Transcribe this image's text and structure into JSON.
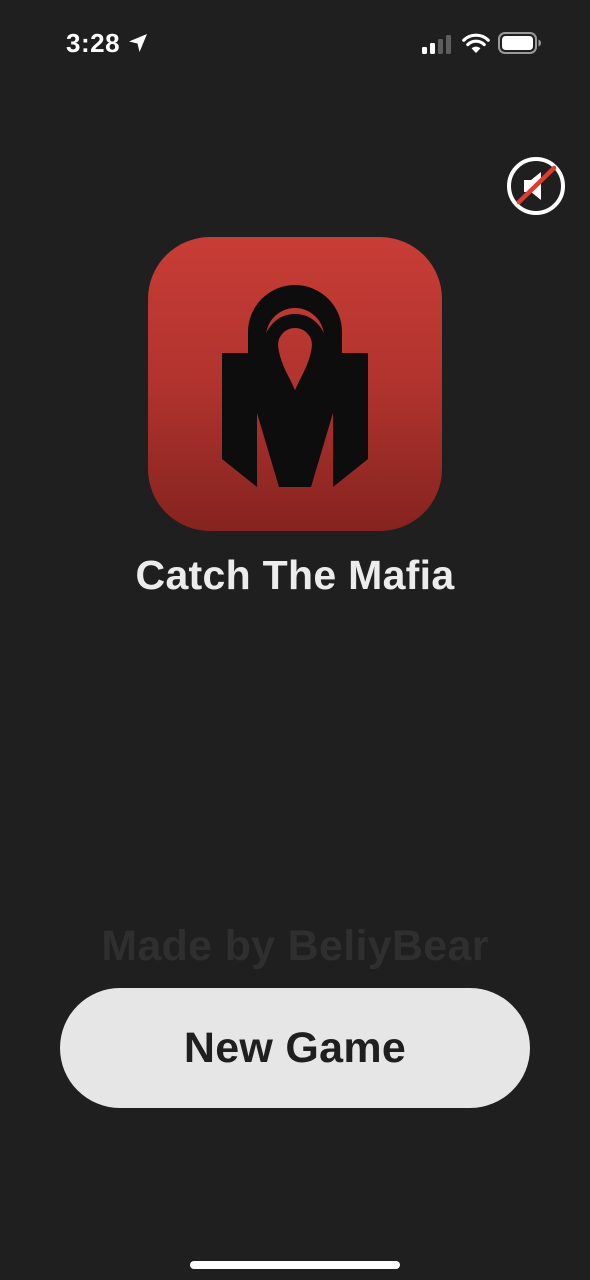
{
  "status_bar": {
    "time": "3:28",
    "location_icon": "location-arrow-icon",
    "signal_icon": "cellular-signal-icon",
    "wifi_icon": "wifi-icon",
    "battery_icon": "battery-icon"
  },
  "sound": {
    "icon": "speaker-muted-icon",
    "state": "muted",
    "accent_color": "#e03a32"
  },
  "logo": {
    "icon": "mafia-m-lock-icon",
    "background_top": "#c83d36",
    "background_bottom": "#85231f"
  },
  "app_title": "Catch The Mafia",
  "credit": "Made by BeliyBear",
  "new_game_label": "New Game"
}
